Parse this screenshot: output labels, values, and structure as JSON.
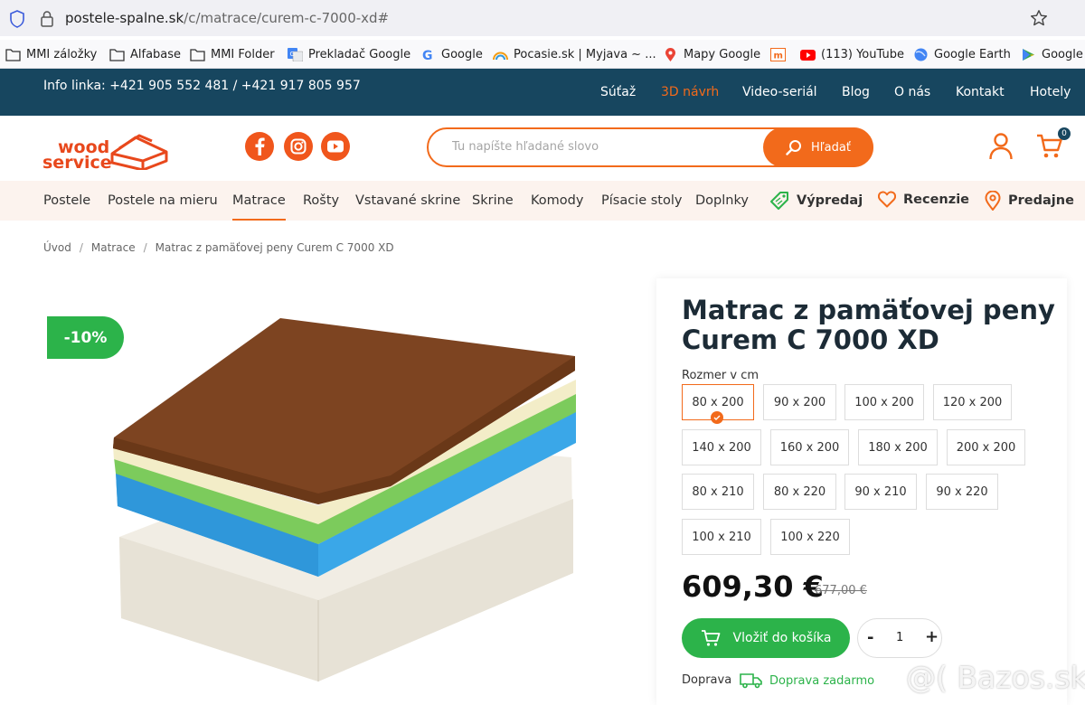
{
  "browser": {
    "url_domain": "postele-spalne.sk",
    "url_path": "/c/matrace/curem-c-7000-xd#",
    "bookmarks": [
      "MMI záložky",
      "Alfabase",
      "MMI Folder",
      "Prekladač Google",
      "Google",
      "Pocasie.sk | Myjava ~ ...",
      "Mapy Google",
      "",
      "(113) YouTube",
      "Google Earth",
      "Google"
    ]
  },
  "infobar": {
    "phones": "Info linka:   +421 905 552 481 / +421 917 805 957",
    "nav": [
      "Súťaž",
      "3D návrh",
      "Video-seriál",
      "Blog",
      "O nás",
      "Kontakt",
      "Hotely"
    ]
  },
  "header": {
    "logo_line1": "wood",
    "logo_line2": "service",
    "search_placeholder": "Tu napíšte hľadané slovo",
    "search_button": "Hľadať",
    "cart_count": "0"
  },
  "categories": [
    "Postele",
    "Postele na mieru",
    "Matrace",
    "Rošty",
    "Vstavané skrine",
    "Skrine",
    "Komody",
    "Písacie stoly",
    "Doplnky",
    "Výpredaj",
    "Recenzie",
    "Predajne"
  ],
  "breadcrumb": [
    "Úvod",
    "Matrace",
    "Matrac z pamäťovej peny Curem C 7000 XD"
  ],
  "product": {
    "discount": "-10%",
    "title": "Matrac z pamäťovej peny Curem C 7000 XD",
    "size_label": "Rozmer v cm",
    "sizes": [
      "80 x 200",
      "90 x 200",
      "100 x 200",
      "120 x 200",
      "140 x 200",
      "160 x 200",
      "180 x 200",
      "200 x 200",
      "80 x 210",
      "80 x 220",
      "90 x 210",
      "90 x 220",
      "100 x 210",
      "100 x 220"
    ],
    "selected_size": "80 x 200",
    "price": "609,30 €",
    "old_price": "677,00 €",
    "add_to_cart": "Vložiť do košíka",
    "quantity": "1",
    "shipping_label": "Doprava",
    "shipping_value": "Doprava zadarmo"
  },
  "watermark": "@( Bazos.sk",
  "colors": {
    "accent_orange": "#f26a1b",
    "navy": "#17465f",
    "green": "#2cb34a"
  }
}
